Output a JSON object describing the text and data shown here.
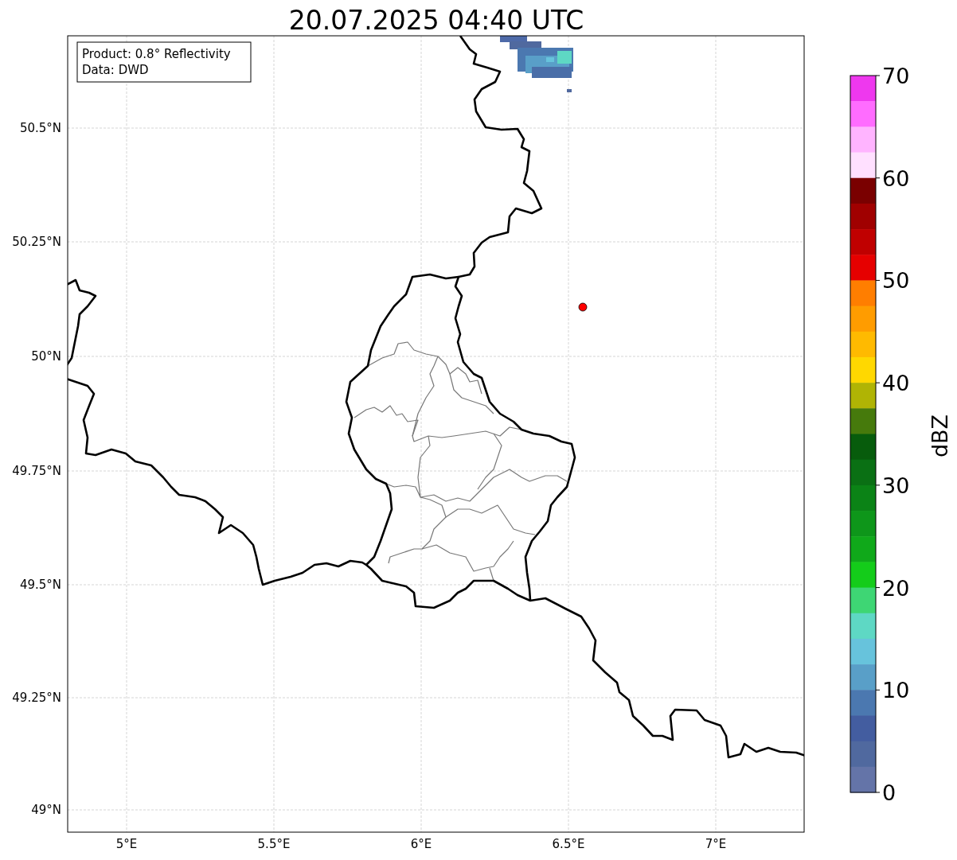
{
  "title": "20.07.2025 04:40 UTC",
  "map": {
    "info_box": [
      "Product: 0.8° Reflectivity",
      "Data: DWD"
    ],
    "x_ticks": [
      "5°E",
      "5.5°E",
      "6°E",
      "6.5°E",
      "7°E"
    ],
    "y_ticks": [
      "50.5°N",
      "50.25°N",
      "50°N",
      "49.75°N",
      "49.5°N",
      "49.25°N",
      "49°N"
    ]
  },
  "colorbar": {
    "label": "dBZ",
    "ticks": [
      "70",
      "60",
      "50",
      "40",
      "30",
      "20",
      "10",
      "0"
    ],
    "bands": [
      {
        "color": "#ee38ee"
      },
      {
        "color": "#ff6cff"
      },
      {
        "color": "#ffb4ff"
      },
      {
        "color": "#ffe0ff"
      },
      {
        "color": "#7a0000"
      },
      {
        "color": "#a00000"
      },
      {
        "color": "#c00000"
      },
      {
        "color": "#e60000"
      },
      {
        "color": "#ff7e00"
      },
      {
        "color": "#ff9c00"
      },
      {
        "color": "#ffba00"
      },
      {
        "color": "#ffd800"
      },
      {
        "color": "#b0b404"
      },
      {
        "color": "#467a0c"
      },
      {
        "color": "#075c0c"
      },
      {
        "color": "#0a7014"
      },
      {
        "color": "#0b8316"
      },
      {
        "color": "#0e961a"
      },
      {
        "color": "#10a91a"
      },
      {
        "color": "#14cc1a"
      },
      {
        "color": "#3ed674"
      },
      {
        "color": "#5ed8c4"
      },
      {
        "color": "#67c3dc"
      },
      {
        "color": "#599fc8"
      },
      {
        "color": "#4b78b0"
      },
      {
        "color": "#435da0"
      },
      {
        "color": "#50699f"
      },
      {
        "color": "#6474a8"
      }
    ]
  }
}
